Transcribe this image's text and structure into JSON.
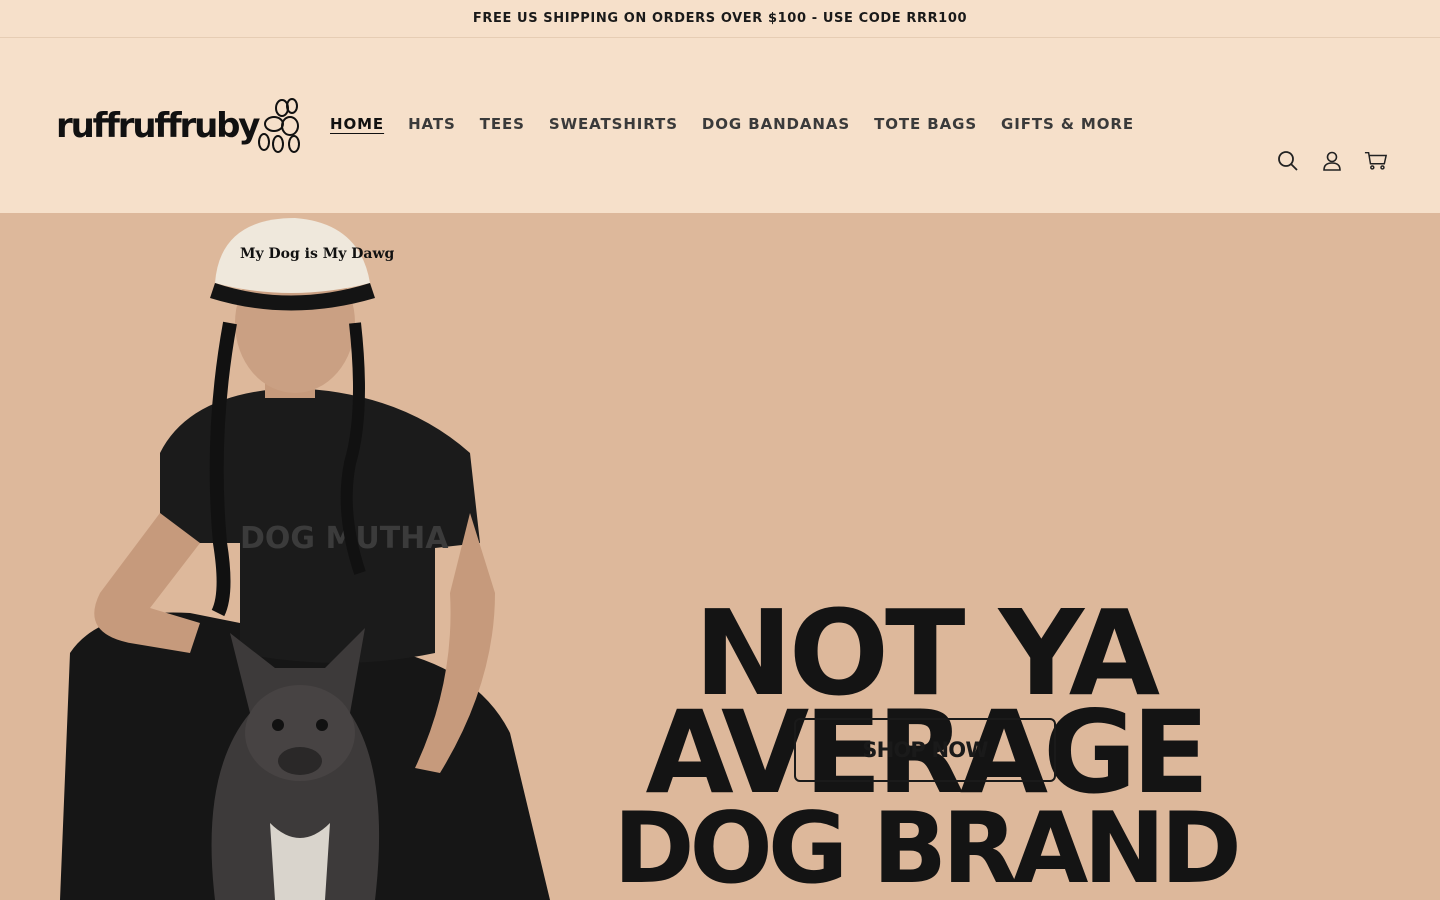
{
  "announcement": {
    "text": "FREE US SHIPPING ON ORDERS OVER $100 - USE CODE RRR100"
  },
  "header": {
    "logo_text": "ruffruffruby",
    "nav": [
      {
        "label": "HOME",
        "active": true
      },
      {
        "label": "HATS",
        "active": false
      },
      {
        "label": "TEES",
        "active": false
      },
      {
        "label": "SWEATSHIRTS",
        "active": false
      },
      {
        "label": "DOG BANDANAS",
        "active": false
      },
      {
        "label": "TOTE BAGS",
        "active": false
      },
      {
        "label": "GIFTS & MORE",
        "active": false
      }
    ],
    "icons": [
      "search-icon",
      "account-icon",
      "cart-icon"
    ]
  },
  "hero": {
    "headline_line1": "NOT YA",
    "headline_line2": "AVERAGE",
    "headline_line3": "DOG BRAND",
    "cta_label": "SHOP NOW",
    "cap_text": "My Dog is My Dawg",
    "shirt_text": "DOG MUTHA",
    "background_color": "#ddb89b"
  },
  "colors": {
    "page_bg": "#f6e0ca",
    "hero_bg": "#ddb89b",
    "text": "#1c1c1c"
  }
}
